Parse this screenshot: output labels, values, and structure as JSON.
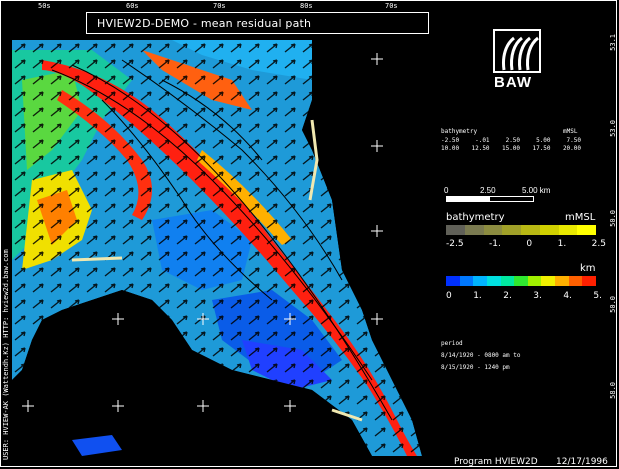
{
  "window": {
    "title": "HVIEW2D-DEMO  -  mean residual path"
  },
  "top_ticks": [
    "50s",
    "60s",
    "70s",
    "80s",
    "70s"
  ],
  "right_ticks": [
    "53.1",
    "53.0",
    "50.0",
    "50.0",
    "58.0"
  ],
  "left_credit": "USER: HVIEW-AK (Wattendh.Kz)    HTTP: hview2d.baw.com",
  "logo": {
    "text": "BAW"
  },
  "bathy_table": {
    "header_left": "bathymetry",
    "header_right": "mMSL",
    "row1": [
      "-2.50",
      "-.01",
      "2.50",
      "5.00",
      "7.50"
    ],
    "row2": [
      "10.00",
      "12.50",
      "15.00",
      "17.50",
      "20.00"
    ]
  },
  "scale": {
    "labels": [
      "0",
      "2.50",
      "5.00 km"
    ]
  },
  "bathy_legend": {
    "title": "bathymetry",
    "unit": "mMSL",
    "ticks": [
      "-2.5",
      "-1.",
      "0",
      "1.",
      "2.5"
    ],
    "colors": [
      "#606058",
      "#7a7a50",
      "#8c8c40",
      "#a0a028",
      "#b8b814",
      "#d0d000",
      "#e8e800",
      "#ffff00"
    ]
  },
  "velocity_legend": {
    "unit": "km",
    "ticks": [
      "0",
      "1.",
      "2.",
      "3.",
      "4.",
      "5."
    ],
    "colors": [
      "#0030ff",
      "#0078ff",
      "#00b4ff",
      "#00e0e0",
      "#00e8a0",
      "#30e830",
      "#a0f000",
      "#f0f000",
      "#ffb000",
      "#ff6000",
      "#ff2000"
    ]
  },
  "period": {
    "heading": "period",
    "line1": "8/14/1920 - 0800 am to",
    "line2": "8/15/1920 - 1240 pm"
  },
  "footer": {
    "program": "Program  HVIEW2D",
    "date": "12/17/1996"
  },
  "colors": {
    "background": "#000000",
    "frame": "#ffffff"
  }
}
